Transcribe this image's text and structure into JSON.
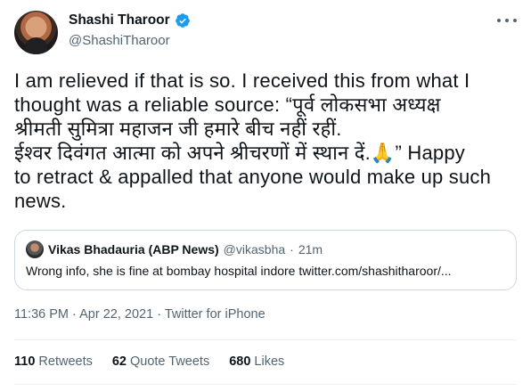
{
  "author": {
    "display_name": "Shashi Tharoor",
    "handle": "@ShashiTharoor",
    "verified_icon": "verified-badge-icon"
  },
  "tweet": {
    "lines": [
      "I am relieved if that is so. I received this from what I",
      "thought was a reliable source: “पूर्व लोकसभा अध्यक्ष",
      "श्रीमती सुमित्रा महाजन जी हमारे बीच नहीं रहीं.",
      "ईश्वर दिवंगत आत्मा को अपने श्रीचरणों में स्थान दें.🙏” Happy",
      "to retract & appalled that anyone would make up such",
      "news."
    ]
  },
  "quote": {
    "display_name": "Vikas Bhadauria (ABP News)",
    "handle": "@vikasbha",
    "separator": "·",
    "time": "21m",
    "text": "Wrong info, she is fine at bombay hospital indore twitter.com/shashitharoor/..."
  },
  "meta": {
    "time": "11:36 PM",
    "sep1": "·",
    "date": "Apr 22, 2021",
    "sep2": "·",
    "source": "Twitter for iPhone"
  },
  "stats": {
    "retweets_count": "110",
    "retweets_label": "Retweets",
    "quotes_count": "62",
    "quotes_label": "Quote Tweets",
    "likes_count": "680",
    "likes_label": "Likes"
  },
  "colors": {
    "text": "#0f1419",
    "secondary": "#536471",
    "verified": "#1d9bf0",
    "border": "#cfd9de"
  }
}
